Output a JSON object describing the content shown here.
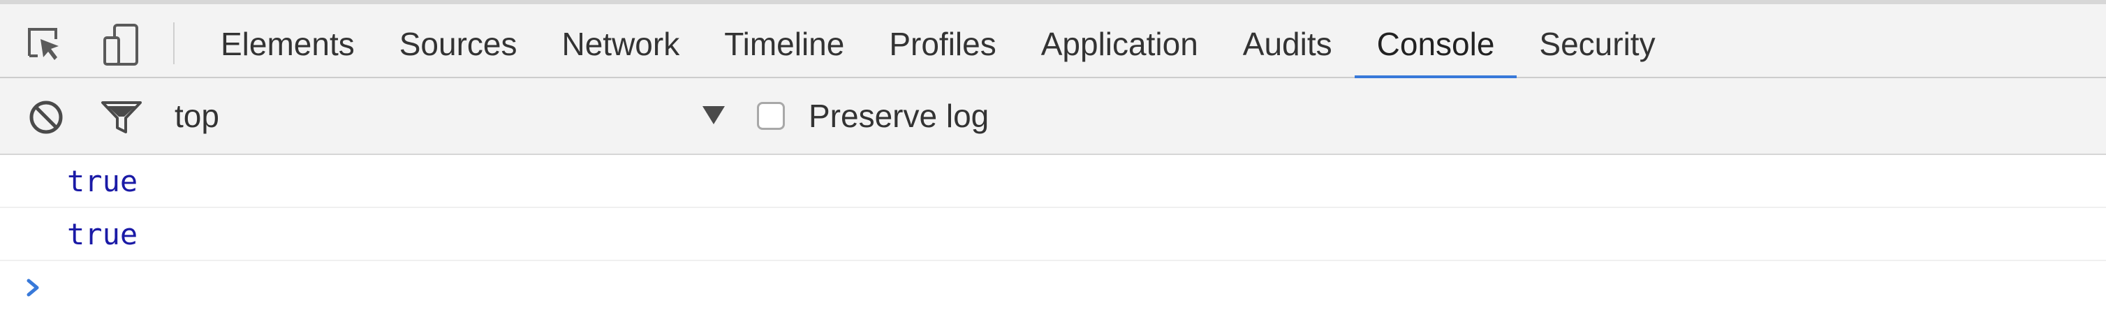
{
  "toolbar_left": {
    "inspect_icon": "inspect-element-icon",
    "device_icon": "device-toolbar-icon"
  },
  "tabs": [
    {
      "label": "Elements",
      "selected": false
    },
    {
      "label": "Sources",
      "selected": false
    },
    {
      "label": "Network",
      "selected": false
    },
    {
      "label": "Timeline",
      "selected": false
    },
    {
      "label": "Profiles",
      "selected": false
    },
    {
      "label": "Application",
      "selected": false
    },
    {
      "label": "Audits",
      "selected": false
    },
    {
      "label": "Console",
      "selected": true
    },
    {
      "label": "Security",
      "selected": false
    }
  ],
  "console_toolbar": {
    "clear_icon": "clear-console-icon",
    "filter_icon": "filter-icon",
    "context": "top",
    "context_arrow_icon": "dropdown-triangle-icon",
    "preserve_log_label": "Preserve log",
    "preserve_log_checked": false
  },
  "messages": [
    {
      "value": "true"
    },
    {
      "value": "true"
    }
  ],
  "prompt_icon": "prompt-chevron-icon",
  "colors": {
    "accent": "#3879d9",
    "value_blue": "#1a1aa6",
    "toolbar_bg": "#f3f3f3",
    "text": "#333333"
  }
}
